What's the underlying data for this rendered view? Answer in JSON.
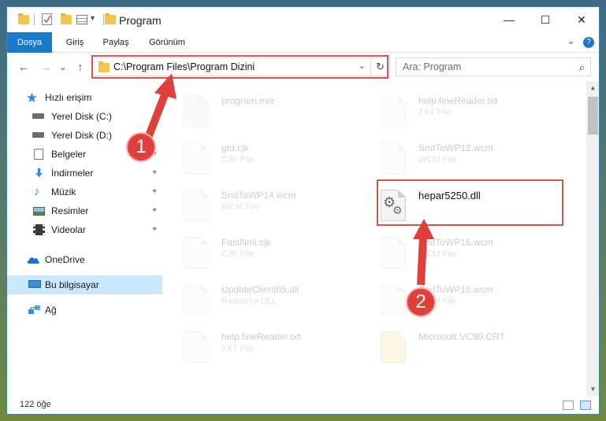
{
  "window": {
    "title": "Program"
  },
  "titlebar": {
    "minimize": "—",
    "maximize": "☐",
    "close": "✕"
  },
  "ribbon": {
    "tabs": [
      {
        "label": "Dosya"
      },
      {
        "label": "Giriş"
      },
      {
        "label": "Paylaş"
      },
      {
        "label": "Görünüm"
      }
    ],
    "expand_chevron": "⌄",
    "help": "?"
  },
  "nav": {
    "back": "←",
    "forward": "→",
    "recent": "⌄",
    "up": "↑",
    "address": "C:\\Program Files\\Program Dizini",
    "address_chevron": "⌄",
    "refresh": "↻",
    "search_placeholder": "Ara: Program",
    "search_icon": "⌕"
  },
  "sidebar": {
    "items": [
      {
        "label": "Hızlı erişim",
        "icon": "star-icon"
      },
      {
        "label": "Yerel Disk (C:)",
        "icon": "drive-icon"
      },
      {
        "label": "Yerel Disk (D:)",
        "icon": "drive-icon"
      },
      {
        "label": "Belgeler",
        "icon": "documents-icon"
      },
      {
        "label": "İndirmeler",
        "icon": "download-icon"
      },
      {
        "label": "Müzik",
        "icon": "music-icon"
      },
      {
        "label": "Resimler",
        "icon": "pictures-icon"
      },
      {
        "label": "Videolar",
        "icon": "videos-icon"
      },
      {
        "label": "OneDrive",
        "icon": "onedrive-icon"
      },
      {
        "label": "Bu bilgisayar",
        "icon": "computer-icon"
      },
      {
        "label": "Ağ",
        "icon": "network-icon"
      }
    ]
  },
  "files": {
    "left": [
      {
        "name": "program.exe",
        "type": ""
      },
      {
        "name": "gtd.cjk",
        "type": "CJK File"
      },
      {
        "name": "SndToWP14.wcm",
        "type": "WCM File"
      },
      {
        "name": "FastNml.cjk",
        "type": "CJK File"
      },
      {
        "name": "UpdateClient65.dll",
        "type": "Resource DLL"
      },
      {
        "name": "help.fineReader.txt",
        "type": "TXT File"
      }
    ],
    "right": [
      {
        "name": "help.fineReader.txt",
        "type": "TXT File"
      },
      {
        "name": "SndToWP12.wcm",
        "type": "WCM File"
      },
      {
        "name": "hepar5250.dll",
        "type": ""
      },
      {
        "name": "SndToWP16.wcm",
        "type": "WCM File"
      },
      {
        "name": "SndToWP15.wcm",
        "type": "WCM File"
      },
      {
        "name": "Microsoft.VC90.CRT",
        "type": ""
      }
    ]
  },
  "status": {
    "count": "122 öğe"
  },
  "callouts": {
    "one": "1",
    "two": "2"
  },
  "colors": {
    "accent": "#1979ca",
    "callout": "#d9534f",
    "selected": "#cce8ff"
  }
}
